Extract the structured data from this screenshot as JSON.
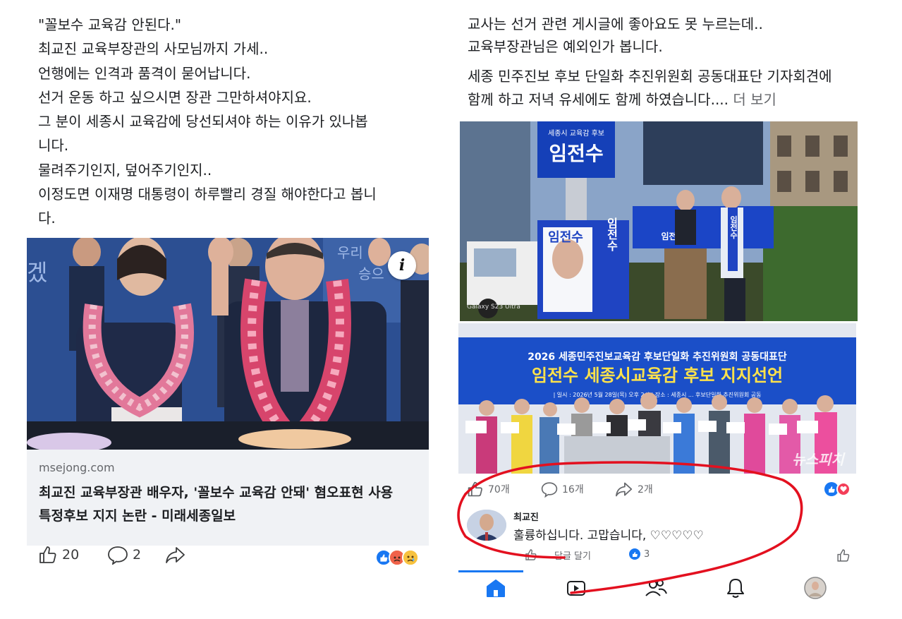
{
  "left_post": {
    "text_lines": [
      "\"꼴보수 교육감 안된다.\"",
      "최교진 교육부장관의 사모님까지 가세..",
      "언행에는 인격과 품격이 묻어납니다.",
      "선거 운동 하고 싶으시면 장관 그만하셔야지요.",
      "그 분이 세종시 교육감에 당선되셔야 하는 이유가 있나봅",
      "니다.",
      "물려주기인지, 덮어주기인지..",
      "이정도면 이재명 대통령이 하루빨리 경질 해야한다고 봅니",
      "다."
    ],
    "link": {
      "info_badge": "i",
      "domain": "msejong.com",
      "title_line1": "최교진 교육부장관 배우자, '꼴보수 교육감 안돼' 혐오표현 사용",
      "title_line2": "특정후보 지지 논란 - 미래세종일보",
      "photo_sign_text": "우리 어",
      "photo_sign_text2": "겠",
      "photo_sign_text3": "승으"
    },
    "actions": {
      "like_count": "20",
      "comment_count": "2",
      "share_label": ""
    },
    "reaction_icons": [
      "like-icon",
      "angry-icon",
      "sad-icon"
    ]
  },
  "right_post": {
    "text_lines": [
      "교사는 선거 관련 게시글에 좋아요도 못 누르는데..",
      "교육부장관님은 예외인가 봅니다."
    ],
    "text_lines2": [
      "세종 민주진보 후보 단일화 추진위원회 공동대표단 기자회견에",
      "함께 하고 저녁 유세에도 함께 하였습니다...."
    ],
    "more_label": "더 보기",
    "photo1": {
      "sign_small": "세종시 교육감 후보",
      "sign_name": "임전수",
      "podium_name": "임전수",
      "truck_name": "임전수",
      "truck_vertical": "임전수",
      "sash": "임전수",
      "watermark": "Galaxy S23 Ultra"
    },
    "photo2": {
      "banner_line1": "2026 세종민주진보교육감 후보단일화 추진위원회 공동대표단",
      "banner_line2": "임전수 세종시교육감 후보 지지선언",
      "banner_small": "| 일시 : 2026년 5월 28일(목) 오후 2시 | 장소 : 세종시 ... 후보단일화 추진위원회 공동",
      "watermark": "뉴스피치"
    },
    "actions": {
      "like_count": "70개",
      "comment_count": "16개",
      "share_count": "2개"
    },
    "comment": {
      "author": "최교진",
      "text": "훌륭하십니다. 고맙습니다, ♡♡♡♡♡",
      "reply_label": "답글 달기",
      "reaction_count": "3"
    },
    "nav": [
      "home-icon",
      "video-icon",
      "friends-icon",
      "bell-icon",
      "profile-avatar"
    ]
  },
  "colors": {
    "brand_blue": "#1877f2",
    "like_blue": "#1877f2",
    "annotation_red": "#e3101f",
    "card_bg": "#f0f2f5",
    "meta_gray": "#65676b"
  }
}
